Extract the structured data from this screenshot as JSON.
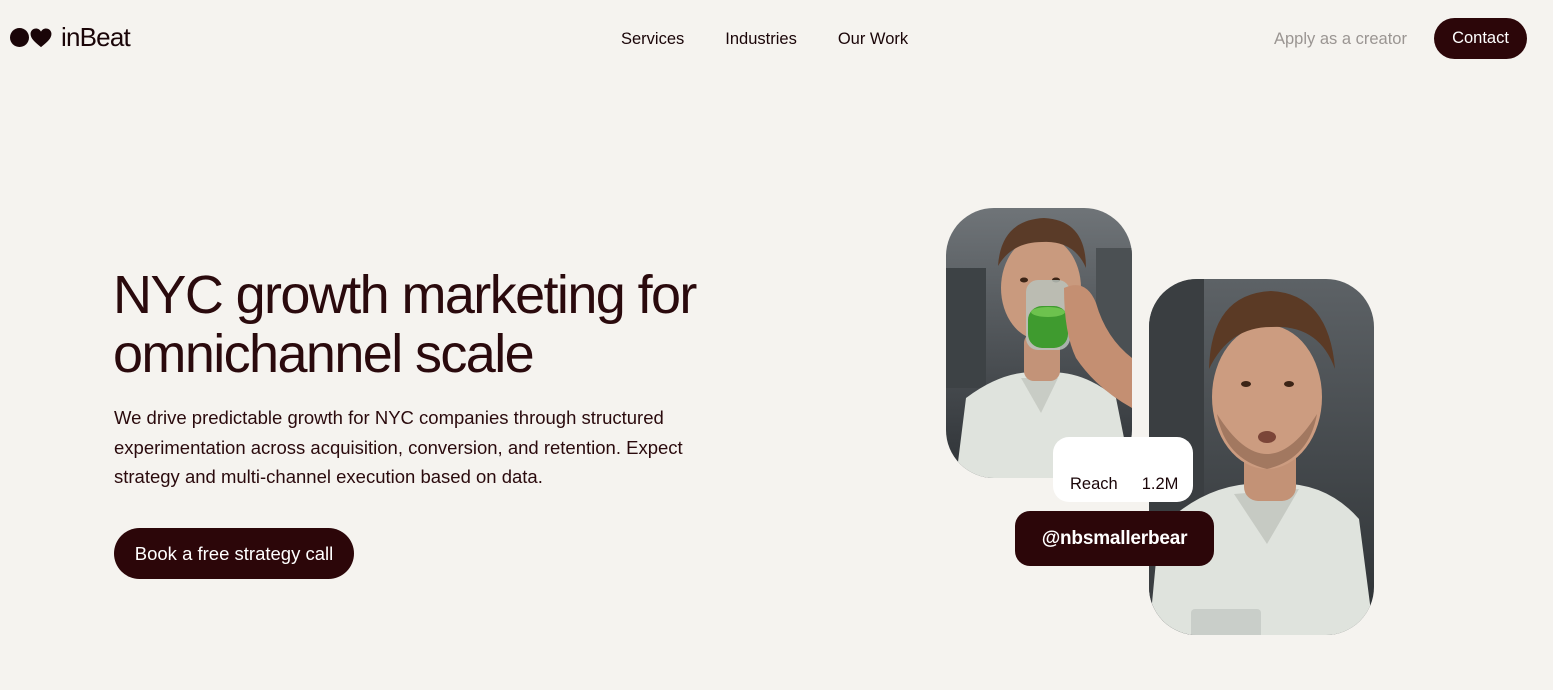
{
  "brand": {
    "name": "inBeat",
    "logo_icons": [
      "dot-icon",
      "heart-icon"
    ]
  },
  "nav": {
    "items": [
      {
        "label": "Services"
      },
      {
        "label": "Industries"
      },
      {
        "label": "Our Work"
      }
    ],
    "apply_label": "Apply as a creator",
    "contact_label": "Contact"
  },
  "hero": {
    "title_line1": "NYC growth marketing for",
    "title_line2": "omnichannel scale",
    "description": "We drive predictable growth for NYC companies through structured experimentation across acquisition, conversion, and retention. Expect strategy and multi-channel execution based on data.",
    "cta_label": "Book a free strategy call"
  },
  "creator": {
    "reach_label": "Reach",
    "reach_value": "1.2M",
    "handle": "@nbsmallerbear"
  },
  "colors": {
    "background": "#f5f3ef",
    "brand_dark": "#2c0609",
    "text": "#2a0a0d",
    "muted": "#9a9592"
  }
}
